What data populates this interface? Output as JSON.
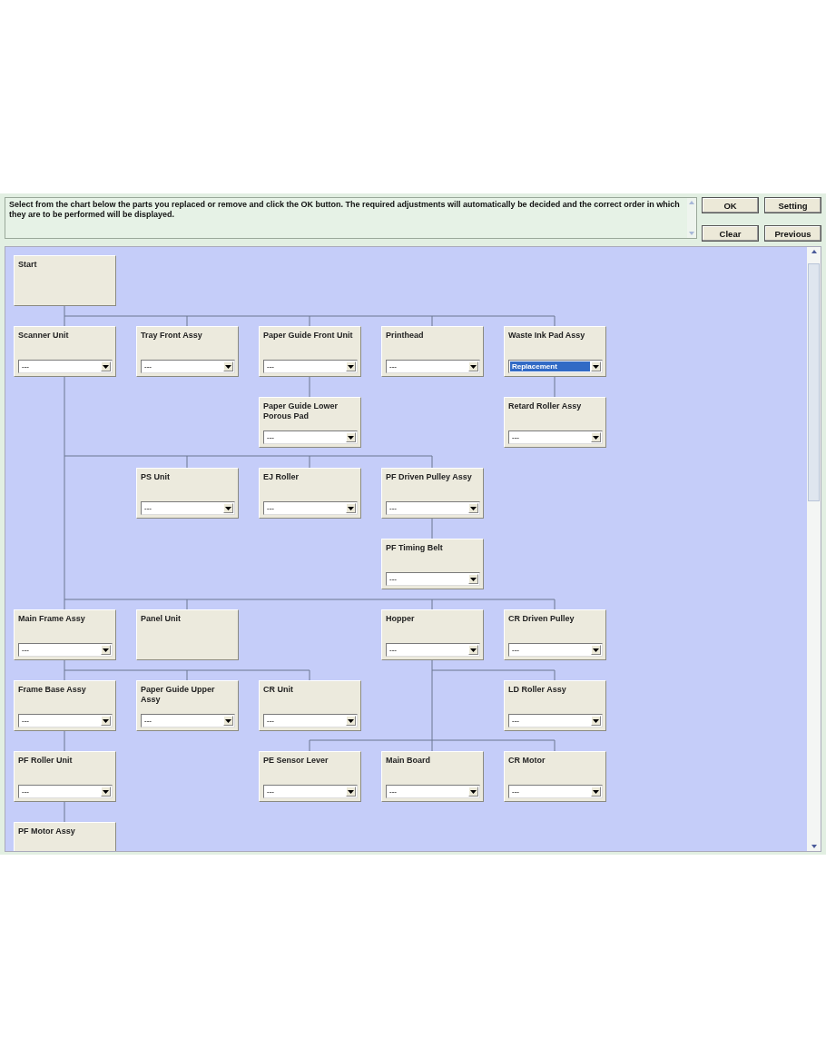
{
  "instructions": "Select from the chart below the parts you replaced or remove and click the OK button. The required adjustments will automatically be decided and the correct order in which they are to be performed will be displayed.",
  "buttons": [
    {
      "label": "OK"
    },
    {
      "label": "Setting"
    },
    {
      "label": "Clear"
    },
    {
      "label": "Previous"
    }
  ],
  "chart": {
    "nodes": [
      {
        "title": "Start",
        "kind": "plain"
      },
      {
        "title": "Scanner Unit",
        "kind": "dropdown",
        "value": "---",
        "focused": false
      },
      {
        "title": "Tray Front Assy",
        "kind": "dropdown",
        "value": "---",
        "focused": false
      },
      {
        "title": "Paper Guide Front Unit",
        "kind": "dropdown",
        "value": "---",
        "focused": false
      },
      {
        "title": "Printhead",
        "kind": "dropdown",
        "value": "---",
        "focused": false
      },
      {
        "title": "Waste Ink Pad Assy",
        "kind": "dropdown",
        "value": "Replacement",
        "focused": true
      },
      {
        "title": "Paper Guide Lower Porous Pad",
        "kind": "dropdown",
        "value": "---",
        "focused": false
      },
      {
        "title": "Retard Roller Assy",
        "kind": "dropdown",
        "value": "---",
        "focused": false
      },
      {
        "title": "PS Unit",
        "kind": "dropdown",
        "value": "---",
        "focused": false
      },
      {
        "title": "EJ Roller",
        "kind": "dropdown",
        "value": "---",
        "focused": false
      },
      {
        "title": "PF Driven Pulley Assy",
        "kind": "dropdown",
        "value": "---",
        "focused": false
      },
      {
        "title": "PF Timing Belt",
        "kind": "dropdown",
        "value": "---",
        "focused": false
      },
      {
        "title": "Main Frame Assy",
        "kind": "dropdown",
        "value": "---",
        "focused": false
      },
      {
        "title": "Panel Unit",
        "kind": "plain"
      },
      {
        "title": "Hopper",
        "kind": "dropdown",
        "value": "---",
        "focused": false
      },
      {
        "title": "CR Driven Pulley",
        "kind": "dropdown",
        "value": "---",
        "focused": false
      },
      {
        "title": "Frame Base Assy",
        "kind": "dropdown",
        "value": "---",
        "focused": false
      },
      {
        "title": "Paper Guide Upper Assy",
        "kind": "dropdown",
        "value": "---",
        "focused": false
      },
      {
        "title": "CR Unit",
        "kind": "dropdown",
        "value": "---",
        "focused": false
      },
      {
        "title": "LD Roller Assy",
        "kind": "dropdown",
        "value": "---",
        "focused": false
      },
      {
        "title": "PF Roller Unit",
        "kind": "dropdown",
        "value": "---",
        "focused": false
      },
      {
        "title": "PE Sensor Lever",
        "kind": "dropdown",
        "value": "---",
        "focused": false
      },
      {
        "title": "Main Board",
        "kind": "dropdown",
        "value": "---",
        "focused": false
      },
      {
        "title": "CR Motor",
        "kind": "dropdown",
        "value": "---",
        "focused": false
      },
      {
        "title": "PF Motor Assy",
        "kind": "plain"
      }
    ]
  }
}
